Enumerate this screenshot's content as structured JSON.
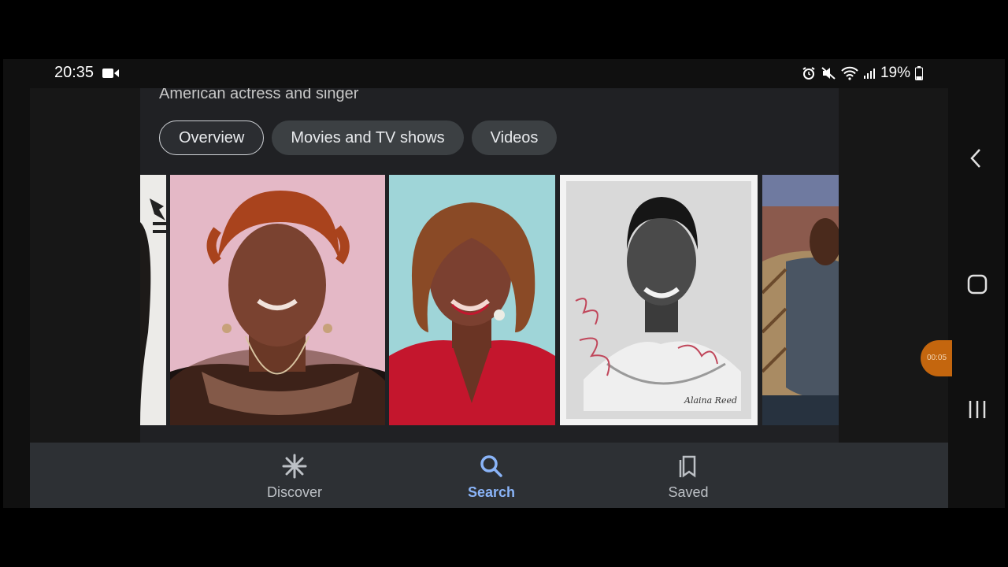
{
  "status_bar": {
    "time": "20:35",
    "battery": "19%",
    "icons": [
      "video-record-icon",
      "alarm-icon",
      "mute-icon",
      "wifi-icon",
      "signal-icon",
      "battery-icon"
    ]
  },
  "knowledge_panel": {
    "subtitle": "American actress and singer",
    "chips": [
      {
        "label": "Overview",
        "active": true
      },
      {
        "label": "Movies and TV shows",
        "active": false
      },
      {
        "label": "Videos",
        "active": false
      }
    ]
  },
  "photos": [
    {
      "name": "photo-partial-left"
    },
    {
      "name": "photo-red-hair-portrait"
    },
    {
      "name": "photo-red-dress-portrait"
    },
    {
      "name": "photo-signed-bw-portrait",
      "signature": "Alaina Reed"
    },
    {
      "name": "photo-partial-right"
    }
  ],
  "bottom_nav": {
    "items": [
      {
        "label": "Discover",
        "icon": "asterisk-icon",
        "active": false
      },
      {
        "label": "Search",
        "icon": "search-icon",
        "active": true
      },
      {
        "label": "Saved",
        "icon": "bookmarks-icon",
        "active": false
      }
    ]
  },
  "recorder": {
    "time": "00:05"
  },
  "colors": {
    "accent": "#8ab4f8",
    "surface": "#202124",
    "nav": "#2d3034",
    "chip": "#3c4043"
  }
}
